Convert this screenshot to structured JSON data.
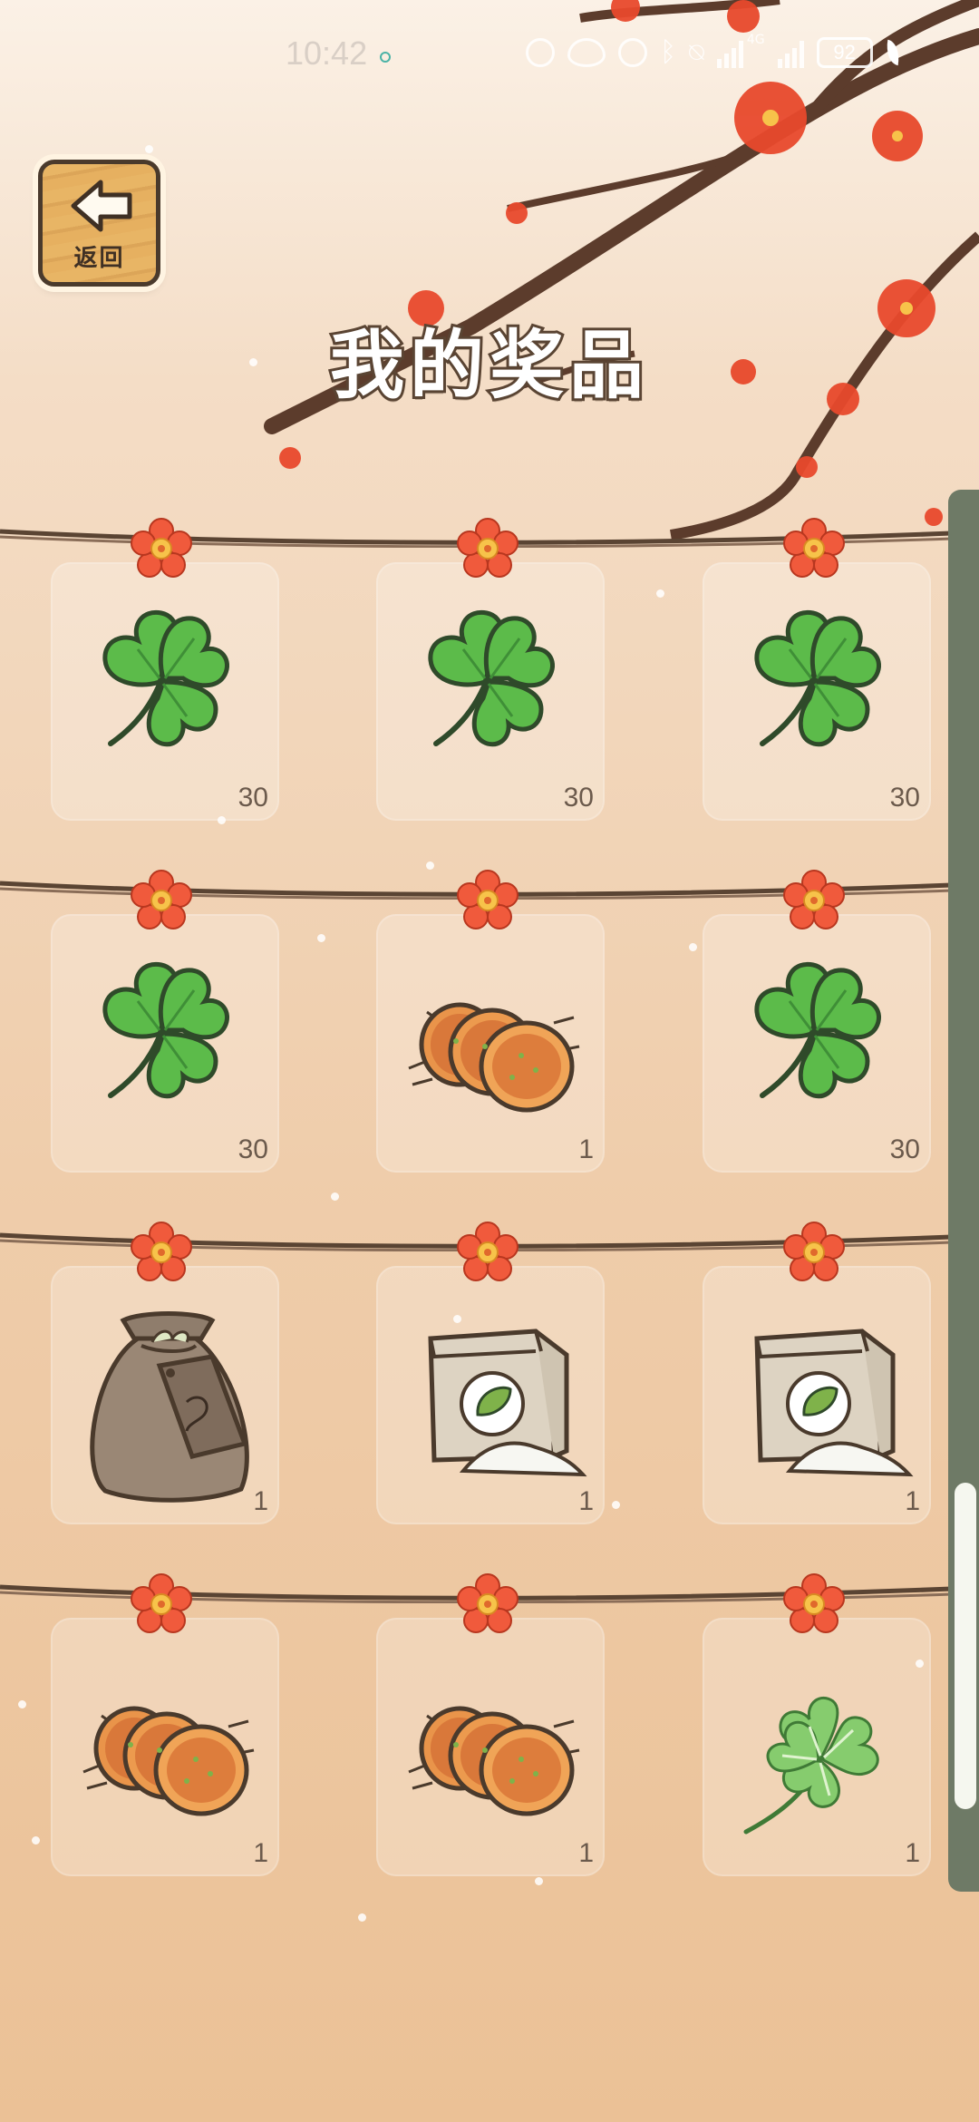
{
  "status_bar": {
    "time": "10:42",
    "network_label": "4G",
    "battery": "92",
    "icons": [
      "hd-icon",
      "eye-icon",
      "alarm-icon",
      "bluetooth-icon",
      "mute-bell-icon",
      "signal-icon",
      "signal-icon",
      "battery-icon",
      "leaf-icon"
    ]
  },
  "header": {
    "back_label": "返回",
    "title": "我的奖品"
  },
  "colors": {
    "clover": "#5cbb4a",
    "clover_outline": "#2f4a2a",
    "blossom": "#f05a3c",
    "scrollbar_track": "#6e7a66",
    "scrollbar_thumb": "#f5f7ef"
  },
  "prizes": [
    {
      "icon": "clover-icon",
      "count": "30"
    },
    {
      "icon": "clover-icon",
      "count": "30"
    },
    {
      "icon": "clover-icon",
      "count": "30"
    },
    {
      "icon": "clover-icon",
      "count": "30"
    },
    {
      "icon": "pancakes-icon",
      "count": "1"
    },
    {
      "icon": "clover-icon",
      "count": "30"
    },
    {
      "icon": "seed-bag-icon",
      "count": "1"
    },
    {
      "icon": "flour-bag-icon",
      "count": "1"
    },
    {
      "icon": "flour-bag-icon",
      "count": "1"
    },
    {
      "icon": "pancakes-icon",
      "count": "1"
    },
    {
      "icon": "pancakes-icon",
      "count": "1"
    },
    {
      "icon": "four-leaf-clover-icon",
      "count": "1"
    }
  ],
  "scroll": {
    "position_fraction": 0.71,
    "visible_fraction": 0.23
  }
}
